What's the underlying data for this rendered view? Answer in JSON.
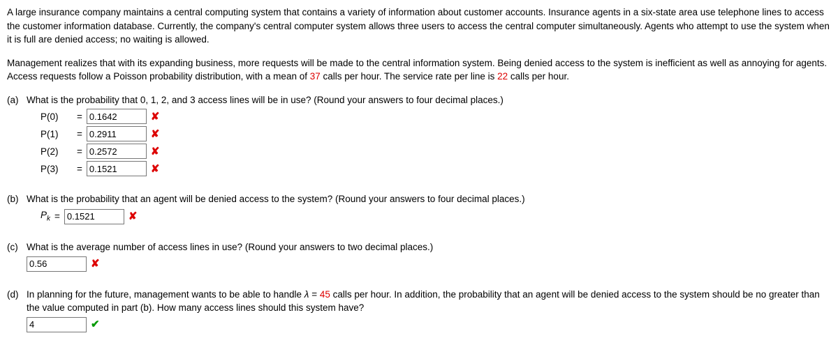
{
  "intro1_a": "A large insurance company maintains a central computing system that contains a variety of information about customer accounts. Insurance agents in a six-state area use telephone lines to access the customer information database. Currently, the company's central computer system allows three users to access the central computer simultaneously. Agents who attempt to use the system when it is full are denied access; no waiting is allowed.",
  "intro2_a": "Management realizes that with its expanding business, more requests will be made to the central information system. Being denied access to the system is inefficient as well as annoying for agents. Access requests follow a Poisson probability distribution, with a mean of ",
  "intro2_red1": "37",
  "intro2_b": " calls per hour. The service rate per line is ",
  "intro2_red2": "22",
  "intro2_c": " calls per hour.",
  "parts": {
    "a": {
      "label": "(a)",
      "question": "What is the probability that 0, 1, 2, and 3 access lines will be in use? (Round your answers to four decimal places.)",
      "rows": [
        {
          "lhs": "P(0)",
          "value": "0.1642",
          "status": "wrong"
        },
        {
          "lhs": "P(1)",
          "value": "0.2911",
          "status": "wrong"
        },
        {
          "lhs": "P(2)",
          "value": "0.2572",
          "status": "wrong"
        },
        {
          "lhs": "P(3)",
          "value": "0.1521",
          "status": "wrong"
        }
      ]
    },
    "b": {
      "label": "(b)",
      "question": "What is the probability that an agent will be denied access to the system? (Round your answers to four decimal places.)",
      "lhs_p": "P",
      "lhs_sub": "k",
      "value": "0.1521",
      "status": "wrong"
    },
    "c": {
      "label": "(c)",
      "question": "What is the average number of access lines in use? (Round your answers to two decimal places.)",
      "value": "0.56",
      "status": "wrong"
    },
    "d": {
      "label": "(d)",
      "q1": "In planning for the future, management wants to be able to handle ",
      "lambda": "λ",
      "eq": " = ",
      "q_red": "45",
      "q2": " calls per hour. In addition, the probability that an agent will be denied access to the system should be no greater than the value computed in part (b). How many access lines should this system have?",
      "value": "4",
      "status": "right"
    }
  },
  "marks": {
    "wrong": "✘",
    "right": "✔"
  }
}
